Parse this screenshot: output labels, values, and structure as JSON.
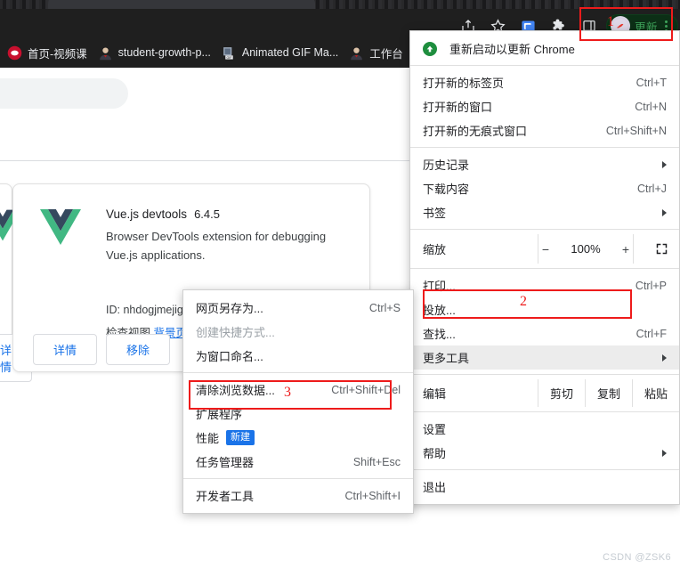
{
  "browser": {
    "toolbar_icons": [
      "share-icon",
      "bookmark-star-icon",
      "cast-blue-icon",
      "extensions-puzzle-icon",
      "side-panel-icon"
    ],
    "update_button_label": "更新",
    "menu_dots_label": "⋮"
  },
  "bookmarks": [
    {
      "label": "首页-视频课",
      "icon": "video-site-favicon"
    },
    {
      "label": "student-growth-p...",
      "icon": "person-favicon"
    },
    {
      "label": "Animated GIF Ma...",
      "icon": "gif-maker-favicon"
    },
    {
      "label": "工作台",
      "icon": "person-favicon"
    }
  ],
  "extensions_page": {
    "card": {
      "name": "Vue.js devtools",
      "version": "6.4.5",
      "description": "Browser DevTools extension for debugging Vue.js applications.",
      "id_label": "ID:",
      "id_value": "nhdogjmejiglincconnnnanhhledaihnd",
      "views_label": "检查视图",
      "views_link": "背景页",
      "details_button": "详情",
      "remove_button": "移除"
    }
  },
  "chrome_menu": {
    "update_item": "重新启动以更新 Chrome",
    "items": [
      {
        "label": "打开新的标签页",
        "accel": "Ctrl+T"
      },
      {
        "label": "打开新的窗口",
        "accel": "Ctrl+N"
      },
      {
        "label": "打开新的无痕式窗口",
        "accel": "Ctrl+Shift+N"
      }
    ],
    "items2": [
      {
        "label": "历史记录",
        "accel": "",
        "arrow": true
      },
      {
        "label": "下载内容",
        "accel": "Ctrl+J",
        "arrow": false
      },
      {
        "label": "书签",
        "accel": "",
        "arrow": true
      }
    ],
    "zoom": {
      "label": "缩放",
      "minus": "−",
      "value": "100%",
      "plus": "+",
      "fullscreen": "fullscreen-icon"
    },
    "items3": [
      {
        "label": "打印...",
        "accel": "Ctrl+P"
      },
      {
        "label": "投放...",
        "accel": ""
      },
      {
        "label": "查找...",
        "accel": "Ctrl+F"
      }
    ],
    "more_tools": {
      "label": "更多工具",
      "arrow": true
    },
    "edit": {
      "label": "编辑",
      "cut": "剪切",
      "copy": "复制",
      "paste": "粘贴"
    },
    "items4": [
      {
        "label": "设置",
        "accel": "",
        "arrow": false
      },
      {
        "label": "帮助",
        "accel": "",
        "arrow": true
      }
    ],
    "exit": {
      "label": "退出"
    }
  },
  "submenu": {
    "group1": [
      {
        "label": "网页另存为...",
        "accel": "Ctrl+S",
        "disabled": false
      },
      {
        "label": "创建快捷方式...",
        "accel": "",
        "disabled": true
      },
      {
        "label": "为窗口命名...",
        "accel": "",
        "disabled": false
      }
    ],
    "group2": [
      {
        "label": "清除浏览数据...",
        "accel": "Ctrl+Shift+Del",
        "disabled": false,
        "badge": ""
      },
      {
        "label": "扩展程序",
        "accel": "",
        "disabled": false,
        "badge": ""
      },
      {
        "label": "性能",
        "accel": "",
        "disabled": false,
        "badge": "新建"
      },
      {
        "label": "任务管理器",
        "accel": "Shift+Esc",
        "disabled": false,
        "badge": ""
      }
    ],
    "group3": [
      {
        "label": "开发者工具",
        "accel": "Ctrl+Shift+I",
        "disabled": false
      }
    ]
  },
  "annotations": {
    "step1": "1",
    "step2": "2",
    "step3": "3",
    "color": "#ee1b1b"
  },
  "watermark": "CSDN @ZSK6"
}
